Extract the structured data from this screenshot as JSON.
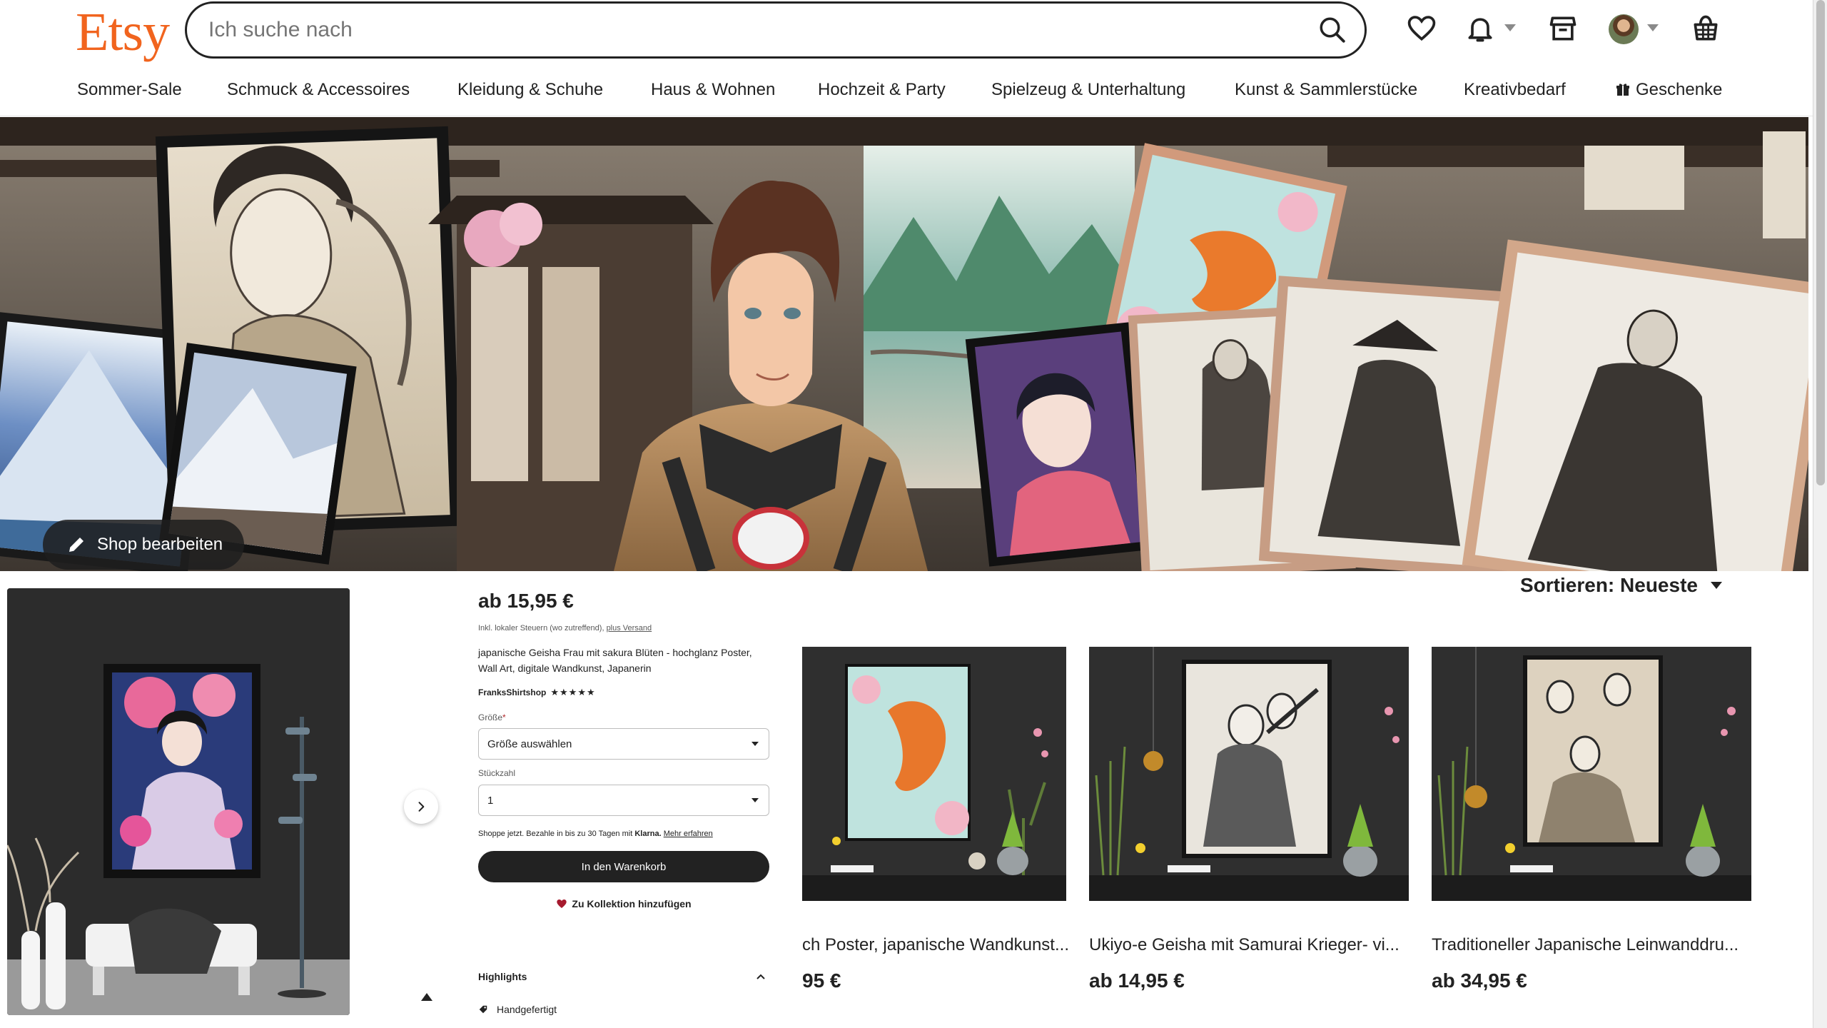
{
  "brand": {
    "logo": "Etsy",
    "accent": "#f1641e"
  },
  "search": {
    "placeholder": "Ich suche nach"
  },
  "header_icons": [
    "heart-icon",
    "bell-icon",
    "shop-manager-icon",
    "avatar",
    "basket-icon"
  ],
  "nav": [
    "Sommer-Sale",
    "Schmuck & Accessoires",
    "Kleidung & Schuhe",
    "Haus & Wohnen",
    "Hochzeit & Party",
    "Spielzeug & Unterhaltung",
    "Kunst & Sammlerstücke",
    "Kreativbedarf",
    "Geschenke"
  ],
  "banner": {
    "edit_label": "Shop bearbeiten"
  },
  "listing_preview": {
    "price": "ab 15,95 €",
    "tax_note": "Inkl. lokaler Steuern (wo zutreffend),",
    "tax_link": "plus Versand",
    "title": "japanische Geisha Frau mit sakura Blüten - hochglanz Poster, Wall Art, digitale Wandkunst, Japanerin",
    "shop_name": "FranksShirtshop",
    "stars": "★★★★★",
    "size_label": "Größe",
    "size_value": "Größe auswählen",
    "qty_label": "Stückzahl",
    "qty_value": "1",
    "klarna_text": "Shoppe jetzt. Bezahle in bis zu 30 Tagen mit",
    "klarna_brand": "Klarna.",
    "klarna_link": "Mehr erfahren",
    "cart_button": "In den Warenkorb",
    "collection_button": "Zu Kollektion hinzufügen",
    "highlights_title": "Highlights",
    "highlight_item": "Handgefertigt"
  },
  "sort": {
    "label": "Sortieren: Neueste"
  },
  "products": [
    {
      "title": "ch Poster, japanische Wandkunst...",
      "price": "95 €"
    },
    {
      "title": "Ukiyo-e Geisha mit Samurai Krieger- vi...",
      "price": "ab 14,95 €"
    },
    {
      "title": "Traditioneller Japanische Leinwanddru...",
      "price": "ab 34,95 €"
    }
  ]
}
